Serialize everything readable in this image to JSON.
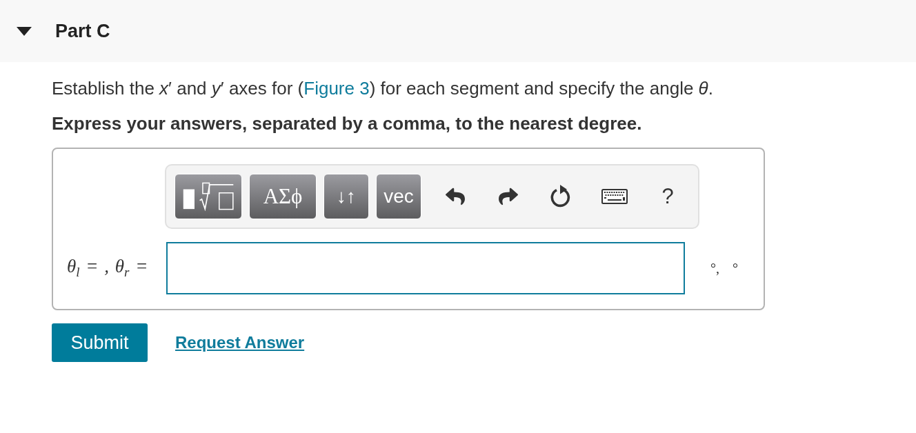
{
  "part": {
    "title": "Part C",
    "expanded": true
  },
  "question": {
    "before": "Establish the *x*′ and *y*′ axes for (",
    "link": "Figure 3",
    "after": ") for each segment and specify the angle *θ*."
  },
  "instruction": "Express your answers, separated by a comma, to the nearest degree.",
  "answer": {
    "toolbar": [
      {
        "kind": "templates"
      },
      {
        "kind": "greek",
        "label": "ΑΣϕ"
      },
      {
        "kind": "arrows",
        "label": "↓↑"
      },
      {
        "kind": "vector",
        "label": "vec"
      },
      {
        "kind": "undo"
      },
      {
        "kind": "redo"
      },
      {
        "kind": "reset"
      },
      {
        "kind": "keyboard"
      },
      {
        "kind": "help",
        "label": "?"
      }
    ],
    "label": "θ$_{l}$ = , θ$_{r}$ =",
    "units": "°, °"
  },
  "actions": {
    "submit": "Submit",
    "request": "Request Answer"
  }
}
